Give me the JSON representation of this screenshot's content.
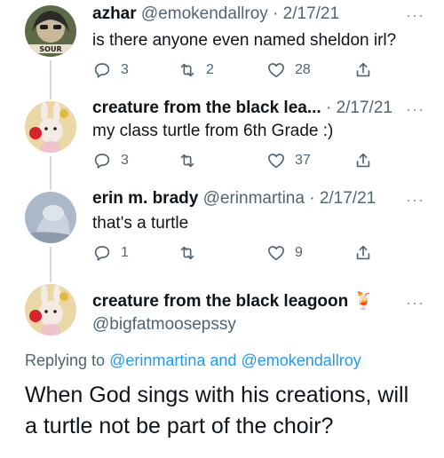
{
  "tweets": [
    {
      "name": "azhar",
      "handle": "@emokendallroy",
      "date": "2/17/21",
      "text": "is there anyone even named sheldon irl?",
      "avatar_badge": "SOUR",
      "reply_count": "3",
      "retweet_count": "2",
      "like_count": "28"
    },
    {
      "name": "creature from the black lea...",
      "date": "2/17/21",
      "text": "my class turtle from 6th Grade :)",
      "reply_count": "3",
      "retweet_count": "",
      "like_count": "37"
    },
    {
      "name": "erin m. brady",
      "handle": "@erinmartina",
      "date": "2/17/21",
      "text": "that's a turtle",
      "reply_count": "1",
      "retweet_count": "",
      "like_count": "9"
    }
  ],
  "main_tweet": {
    "name": "creature from the black leagoon",
    "handle": "@bigfatmoosepssy",
    "replying_prefix": "Replying to",
    "replying_user1": "@erinmartina",
    "replying_and": "and",
    "replying_user2": "@emokendallroy",
    "text_line1": "When God sings with his creations, will",
    "text_line2": "a turtle not be part of the choir?"
  },
  "ui": {
    "separator": "·",
    "more": "···",
    "drink_emoji": "🍹"
  },
  "icons": [
    "reply-icon",
    "retweet-icon",
    "like-icon",
    "share-icon",
    "more-icon"
  ],
  "colors": {
    "link": "#1d9bf0",
    "secondary": "#536471",
    "text": "#0f1419"
  }
}
